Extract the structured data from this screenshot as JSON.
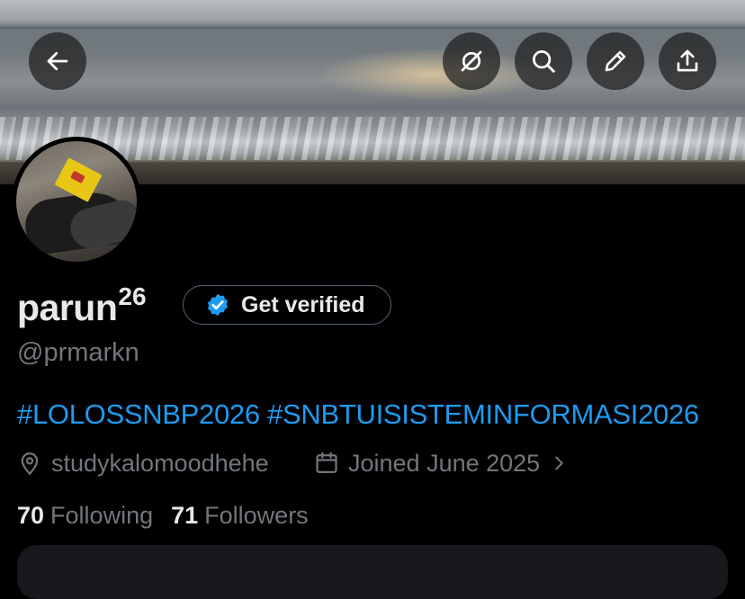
{
  "header": {
    "back_icon": "arrow-left-icon",
    "actions": [
      {
        "name": "grok-icon"
      },
      {
        "name": "search-icon"
      },
      {
        "name": "edit-icon"
      },
      {
        "name": "share-icon"
      }
    ]
  },
  "profile": {
    "name": "parun",
    "name_superscript": "26",
    "verify_label": "Get verified",
    "handle": "@prmarkn",
    "bio": "#LOLOSSNBP2026 #SNBTUISISTEMINFORMASI2026",
    "location": "studykalomoodhehe",
    "joined": "Joined June 2025",
    "following_count": "70",
    "following_label": "Following",
    "followers_count": "71",
    "followers_label": "Followers"
  },
  "colors": {
    "background": "#000000",
    "link": "#1d9bf0",
    "muted": "#71767b",
    "text": "#e7e9ea",
    "verified_badge": "#1d9bf0"
  }
}
